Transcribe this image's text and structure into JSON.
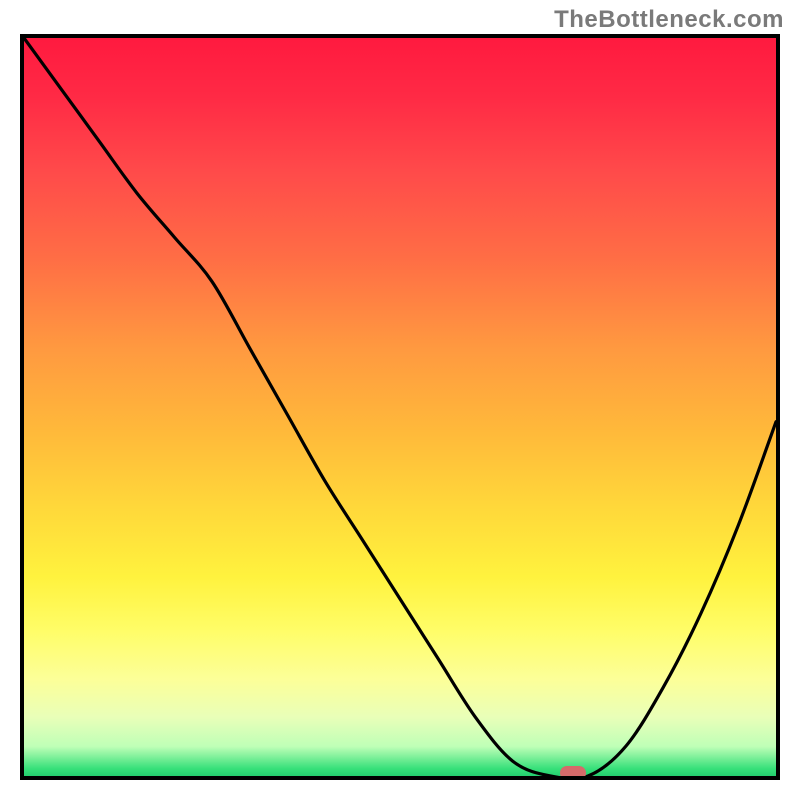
{
  "watermark": "TheBottleneck.com",
  "colors": {
    "gradient_top": "#ff1a3f",
    "gradient_mid": "#ffd93a",
    "gradient_low": "#fcff99",
    "gradient_bottom": "#24cf6f",
    "curve": "#000000",
    "frame": "#000000",
    "marker": "#d66a6a"
  },
  "chart_data": {
    "type": "line",
    "title": "",
    "xlabel": "",
    "ylabel": "",
    "xlim": [
      0,
      100
    ],
    "ylim": [
      0,
      100
    ],
    "grid": false,
    "legend": false,
    "series": [
      {
        "name": "curve",
        "x": [
          0,
          5,
          10,
          15,
          20,
          25,
          30,
          35,
          40,
          45,
          50,
          55,
          60,
          65,
          70,
          75,
          80,
          85,
          90,
          95,
          100
        ],
        "y": [
          100,
          93,
          86,
          79,
          73,
          67,
          58,
          49,
          40,
          32,
          24,
          16,
          8,
          2,
          0,
          0,
          4,
          12,
          22,
          34,
          48
        ]
      }
    ],
    "marker": {
      "x": 73,
      "y": 0
    }
  }
}
